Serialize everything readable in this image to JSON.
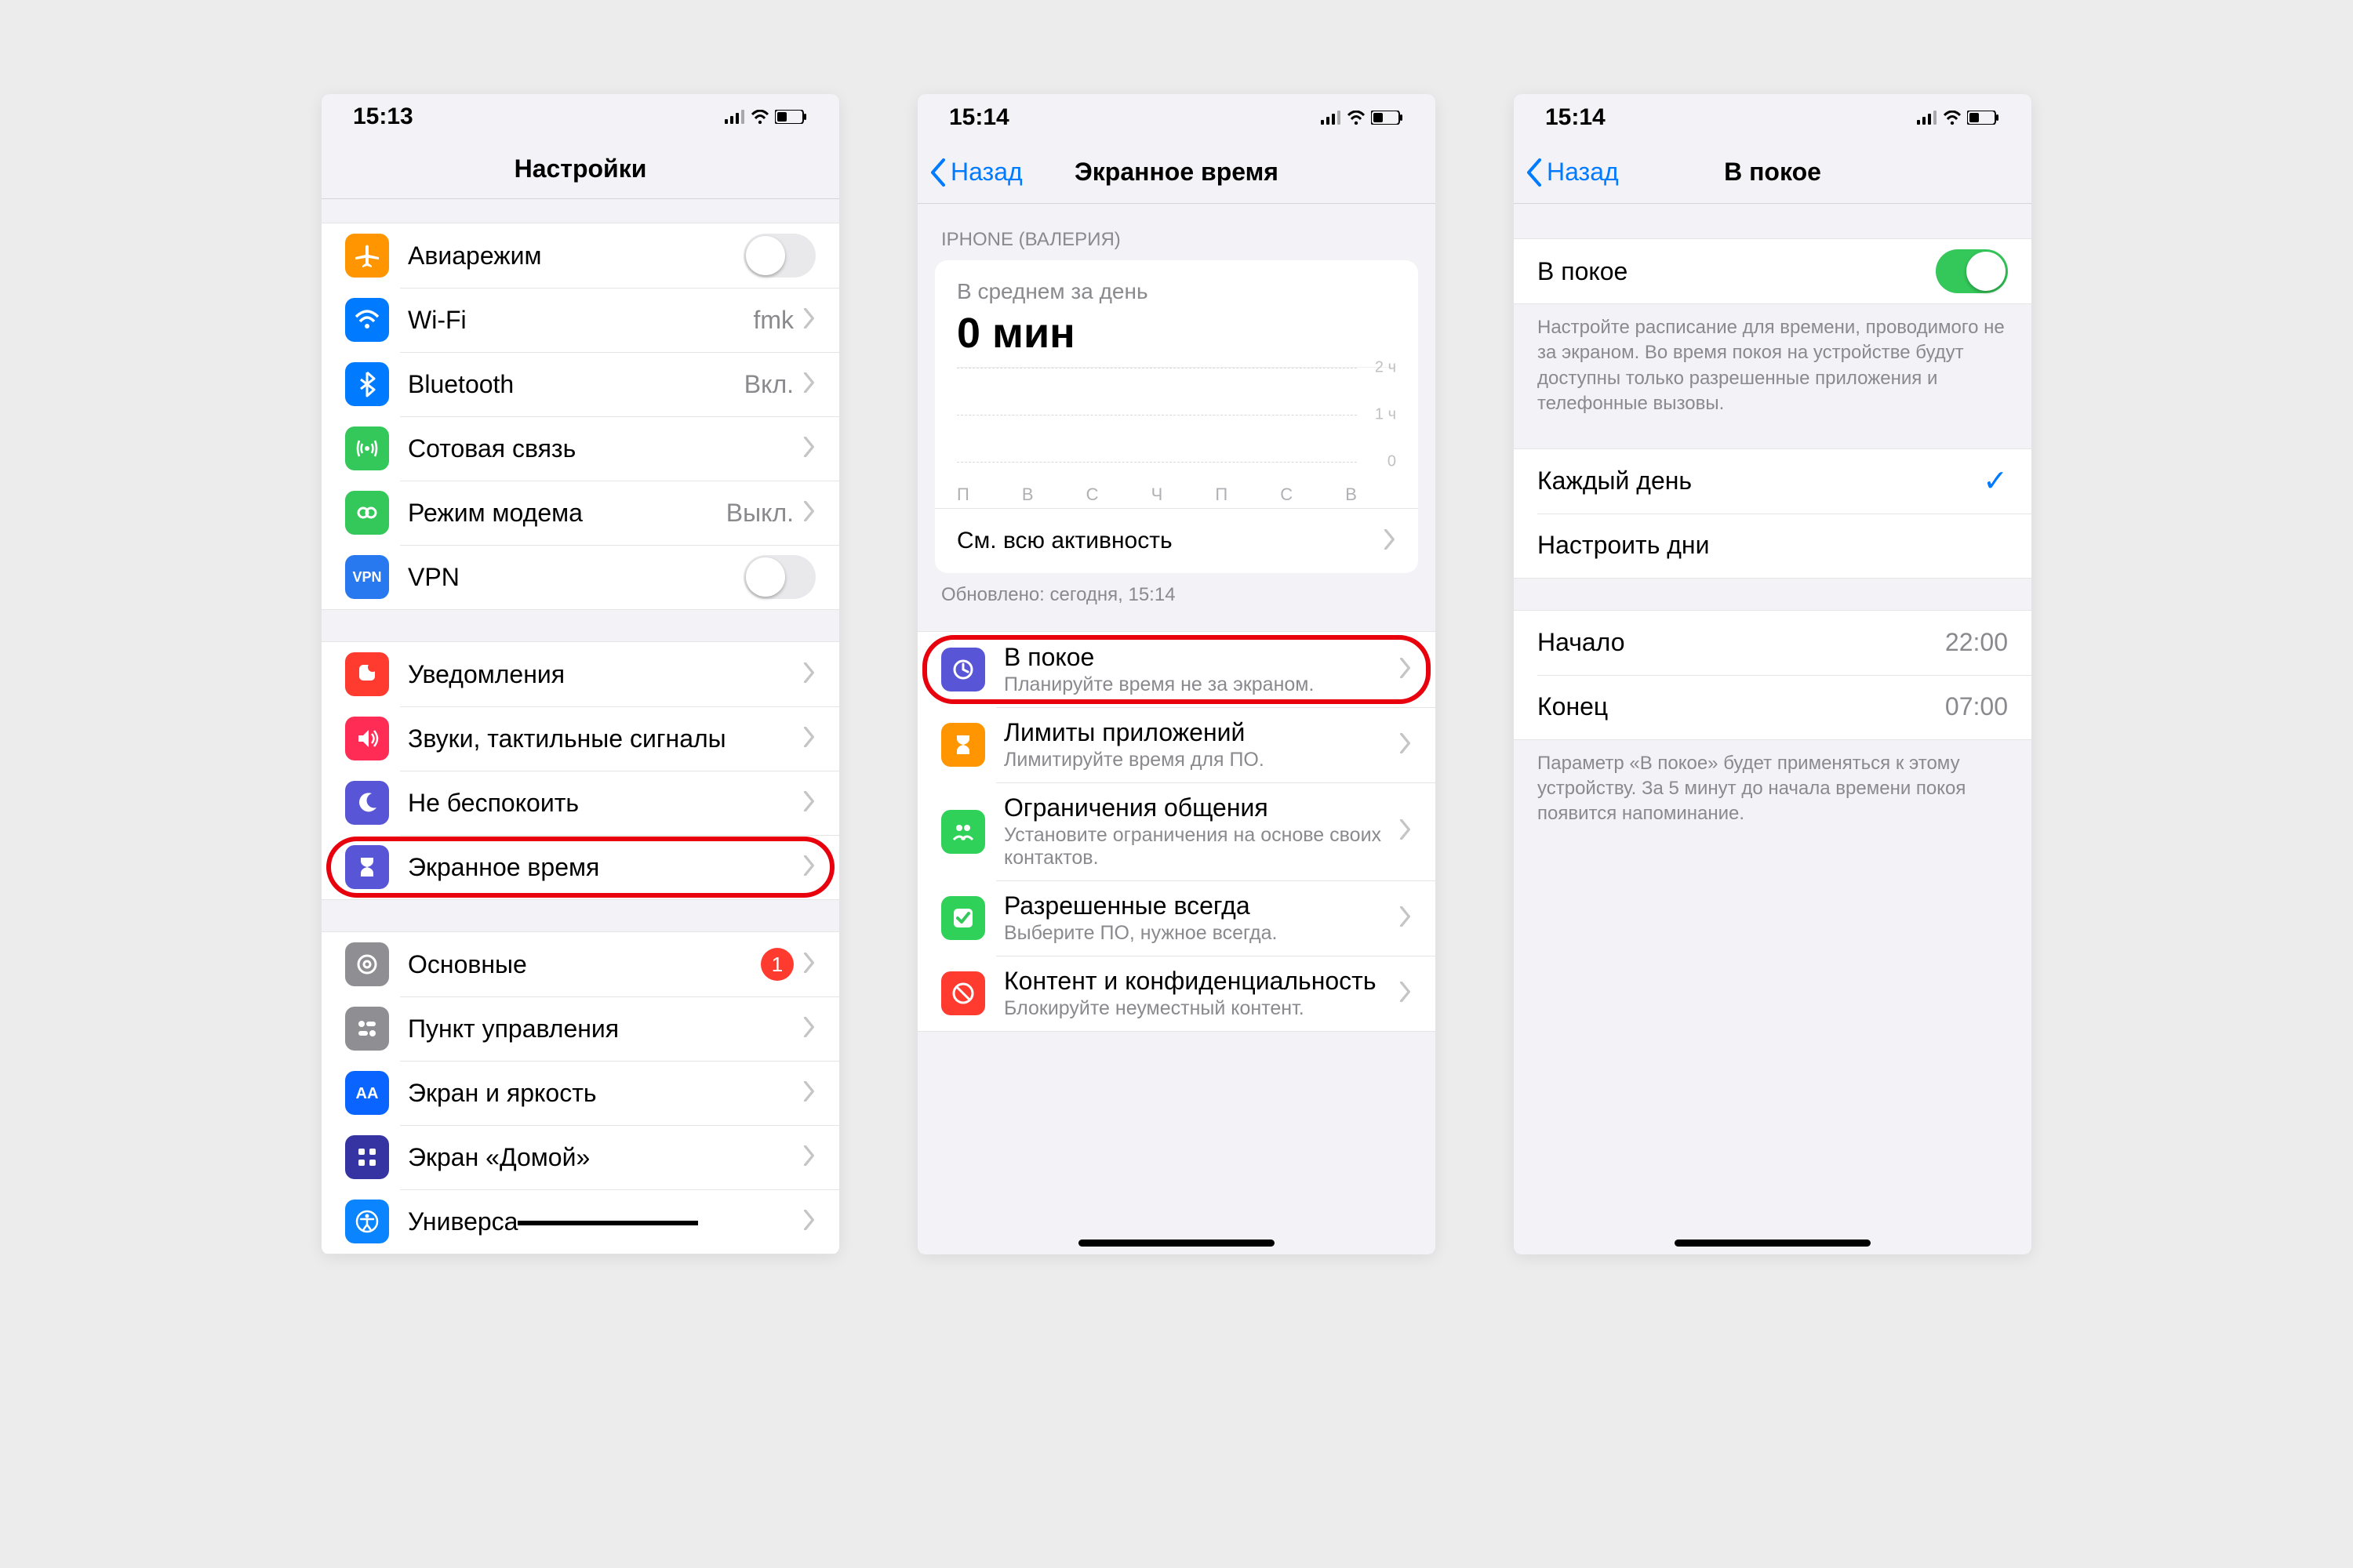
{
  "status": {
    "time1": "15:13",
    "time2": "15:14",
    "time3": "15:14"
  },
  "screen1": {
    "title": "Настройки",
    "rows": {
      "airplane": "Авиарежим",
      "wifi": "Wi-Fi",
      "wifi_val": "fmk",
      "bluetooth": "Bluetooth",
      "bluetooth_val": "Вкл.",
      "cellular": "Сотовая связь",
      "hotspot": "Режим модема",
      "hotspot_val": "Выкл.",
      "vpn": "VPN",
      "notifications": "Уведомления",
      "sounds": "Звуки, тактильные сигналы",
      "dnd": "Не беспокоить",
      "screentime": "Экранное время",
      "general": "Основные",
      "general_badge": "1",
      "control": "Пункт управления",
      "display": "Экран и яркость",
      "home": "Экран «Домой»",
      "accessibility": "Универсальный доступ"
    }
  },
  "screen2": {
    "back": "Назад",
    "title": "Экранное время",
    "device": "IPHONE (ВАЛЕРИЯ)",
    "avg_label": "В среднем за день",
    "avg_value": "0 мин",
    "seeall": "См. всю активность",
    "updated": "Обновлено: сегодня, 15:14",
    "downtime": {
      "title": "В покое",
      "sub": "Планируйте время не за экраном."
    },
    "limits": {
      "title": "Лимиты приложений",
      "sub": "Лимитируйте время для ПО."
    },
    "comm": {
      "title": "Ограничения общения",
      "sub": "Установите ограничения на основе своих контактов."
    },
    "allowed": {
      "title": "Разрешенные всегда",
      "sub": "Выберите ПО, нужное всегда."
    },
    "content": {
      "title": "Контент и конфиденциальность",
      "sub": "Блокируйте неуместный контент."
    }
  },
  "screen3": {
    "back": "Назад",
    "title": "В покое",
    "switch_label": "В покое",
    "footer1": "Настройте расписание для времени, проводимого не за экраном. Во время покоя на устройстве будут доступны только разрешенные приложения и телефонные вызовы.",
    "every_day": "Каждый день",
    "custom": "Настроить дни",
    "start": "Начало",
    "start_val": "22:00",
    "end": "Конец",
    "end_val": "07:00",
    "footer2": "Параметр «В покое» будет применяться к этому устройству. За 5 минут до начала времени покоя появится напоминание."
  },
  "chart_data": {
    "type": "bar",
    "categories": [
      "П",
      "В",
      "С",
      "Ч",
      "П",
      "С",
      "В"
    ],
    "values": [
      0,
      0,
      0,
      0,
      0,
      0,
      0
    ],
    "title": "В среднем за день",
    "ylabel": "ч",
    "yticks": [
      "2 ч",
      "1 ч",
      "0"
    ],
    "ylim": [
      0,
      2
    ]
  }
}
